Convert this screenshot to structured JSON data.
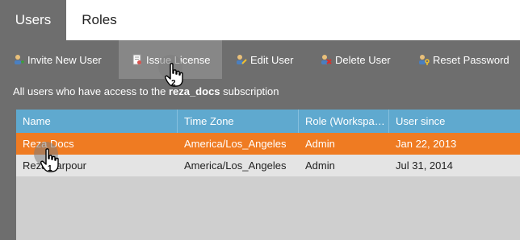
{
  "tabs": [
    {
      "label": "Users"
    },
    {
      "label": "Roles"
    }
  ],
  "toolbar": {
    "invite": "Invite New User",
    "issue": "Issue License",
    "edit": "Edit User",
    "delete": "Delete User",
    "reset": "Reset Password"
  },
  "info": {
    "prefix": "All users who have access to the ",
    "subscription": "reza_docs",
    "suffix": " subscription"
  },
  "grid": {
    "headers": [
      "Name",
      "Time Zone",
      "Role (Workspa…",
      "User since"
    ],
    "rows": [
      {
        "name": "Reza Docs",
        "tz": "America/Los_Angeles",
        "role": "Admin",
        "since": "Jan 22, 2013"
      },
      {
        "name": "Reza Yarpour",
        "tz": "America/Los_Angeles",
        "role": "Admin",
        "since": "Jul 31, 2014"
      }
    ]
  },
  "cursors": [
    {
      "step": "1"
    },
    {
      "step": "2"
    }
  ],
  "colors": {
    "accent": "#ef7b22",
    "header": "#5fa9cf",
    "chrome": "#6e6e6e"
  }
}
